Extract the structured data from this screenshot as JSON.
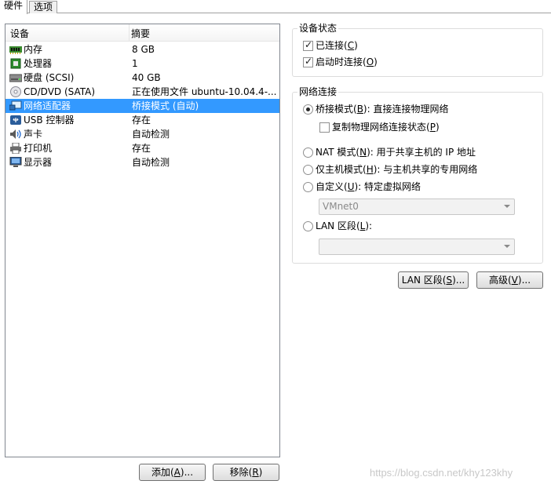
{
  "tabs": [
    {
      "label": "硬件",
      "active": true
    },
    {
      "label": "选项",
      "active": false
    }
  ],
  "device_list": {
    "columns": [
      "设备",
      "摘要"
    ],
    "rows": [
      {
        "name": "内存",
        "summary": "8 GB",
        "icon": "memory-icon"
      },
      {
        "name": "处理器",
        "summary": "1",
        "icon": "processor-icon"
      },
      {
        "name": "硬盘 (SCSI)",
        "summary": "40 GB",
        "icon": "hard-disk-icon"
      },
      {
        "name": "CD/DVD (SATA)",
        "summary": "正在使用文件 ubuntu-10.04.4-...",
        "icon": "cd-dvd-icon"
      },
      {
        "name": "网络适配器",
        "summary": "桥接模式 (自动)",
        "icon": "network-adapter-icon",
        "selected": true
      },
      {
        "name": "USB 控制器",
        "summary": "存在",
        "icon": "usb-icon"
      },
      {
        "name": "声卡",
        "summary": "自动检测",
        "icon": "sound-card-icon"
      },
      {
        "name": "打印机",
        "summary": "存在",
        "icon": "printer-icon"
      },
      {
        "name": "显示器",
        "summary": "自动检测",
        "icon": "display-icon"
      }
    ]
  },
  "buttons": {
    "add": {
      "prefix": "添加(",
      "key": "A",
      "suffix": ")..."
    },
    "remove": {
      "prefix": "移除(",
      "key": "R",
      "suffix": ")"
    },
    "lan_segments": {
      "prefix": "LAN 区段(",
      "key": "S",
      "suffix": ")..."
    },
    "advanced": {
      "prefix": "高级(",
      "key": "V",
      "suffix": ")..."
    }
  },
  "device_status": {
    "title": "设备状态",
    "connected": {
      "prefix": "已连接(",
      "key": "C",
      "suffix": ")",
      "checked": true
    },
    "connect_on_power": {
      "prefix": "启动时连接(",
      "key": "O",
      "suffix": ")",
      "checked": true
    }
  },
  "network_connection": {
    "title": "网络连接",
    "bridged": {
      "prefix": "桥接模式(",
      "key": "B",
      "suffix": "): 直接连接物理网络",
      "selected": true
    },
    "replicate": {
      "prefix": "复制物理网络连接状态(",
      "key": "P",
      "suffix": ")",
      "checked": false
    },
    "nat": {
      "prefix": "NAT 模式(",
      "key": "N",
      "suffix": "): 用于共享主机的 IP 地址",
      "selected": false
    },
    "host_only": {
      "prefix": "仅主机模式(",
      "key": "H",
      "suffix": "): 与主机共享的专用网络",
      "selected": false
    },
    "custom": {
      "prefix": "自定义(",
      "key": "U",
      "suffix": "): 特定虚拟网络",
      "selected": false
    },
    "custom_select_value": "VMnet0",
    "lan_segment": {
      "prefix": "LAN 区段(",
      "key": "L",
      "suffix": "):",
      "selected": false
    },
    "lan_select_value": ""
  },
  "watermark": "https://blog.csdn.net/khy123khy",
  "colors": {
    "selection": "#3399ff",
    "border": "#828790"
  }
}
